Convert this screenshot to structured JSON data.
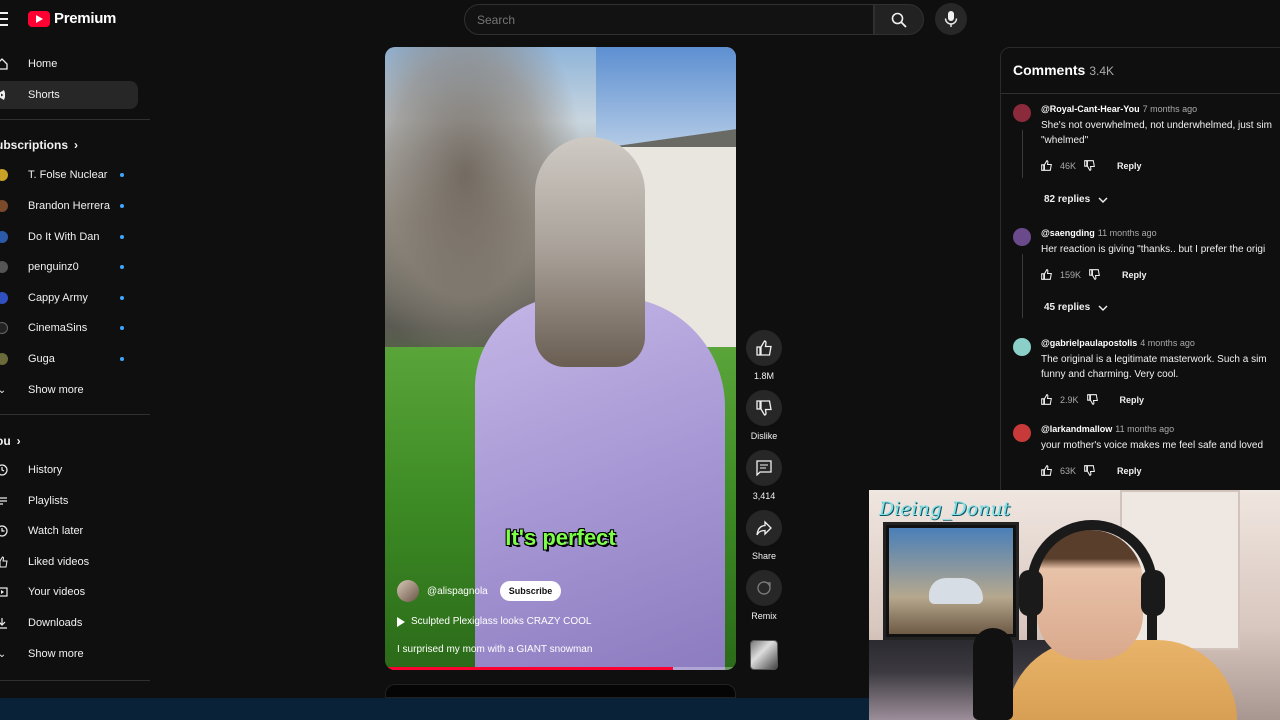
{
  "header": {
    "logo_text": "Premium",
    "search_placeholder": "Search"
  },
  "sidebar": {
    "main": [
      {
        "label": "Home",
        "icon": "home-icon"
      },
      {
        "label": "Shorts",
        "icon": "shorts-icon",
        "active": true
      }
    ],
    "subscriptions_heading": "ubscriptions",
    "subscriptions": [
      {
        "label": "T. Folse Nuclear",
        "color": "#c9a227"
      },
      {
        "label": "Brandon Herrera",
        "color": "#7a4a2a"
      },
      {
        "label": "Do It With Dan",
        "color": "#2a5aa8"
      },
      {
        "label": "penguinz0",
        "color": "#555555"
      },
      {
        "label": "Cappy Army",
        "color": "#3050c0"
      },
      {
        "label": "CinemaSins",
        "color": "#222222"
      },
      {
        "label": "Guga",
        "color": "#6a6a3a"
      }
    ],
    "show_more_1": "Show more",
    "you_heading": "ou",
    "you_items": [
      {
        "label": "History",
        "icon": "history-icon"
      },
      {
        "label": "Playlists",
        "icon": "playlists-icon"
      },
      {
        "label": "Watch later",
        "icon": "watch-later-icon"
      },
      {
        "label": "Liked videos",
        "icon": "like-icon"
      },
      {
        "label": "Your videos",
        "icon": "your-videos-icon"
      },
      {
        "label": "Downloads",
        "icon": "download-icon"
      }
    ],
    "show_more_2": "Show more"
  },
  "video": {
    "caption": "It's perfect",
    "channel": "@alispagnola",
    "subscribe": "Subscribe",
    "related": "Sculpted Plexiglass looks CRAZY COOL",
    "description": "I surprised my mom with a GIANT snowman",
    "progress": 0.82
  },
  "actions": {
    "likes": "1.8M",
    "dislike": "Dislike",
    "comments": "3,414",
    "share": "Share",
    "remix": "Remix"
  },
  "comments": {
    "title": "Comments",
    "count": "3.4K",
    "reply_label": "Reply",
    "items": [
      {
        "author": "@Royal-Cant-Hear-You",
        "time": "7 months ago",
        "text": "She's not overwhelmed, not underwhelmed, just sim\n\"whelmed\"",
        "likes": "46K",
        "replies": "82 replies",
        "avatar_color": "#8a2a3a"
      },
      {
        "author": "@saengding",
        "time": "11 months ago",
        "text": "Her reaction is giving \"thanks.. but I prefer the origi",
        "likes": "159K",
        "replies": "45 replies",
        "avatar_color": "#6a4a8a"
      },
      {
        "author": "@gabrielpaulapostolis",
        "time": "4 months ago",
        "text": "The original is a legitimate masterwork. Such a sim\nfunny and charming. Very cool.",
        "likes": "2.9K",
        "avatar_color": "#8ad0c8"
      },
      {
        "author": "@larkandmallow",
        "time": "11 months ago",
        "text": "your mother's voice makes me feel safe and loved",
        "likes": "63K",
        "avatar_color": "#c83a3a"
      }
    ]
  },
  "webcam": {
    "overlay_name": "Dieing_Donut"
  }
}
